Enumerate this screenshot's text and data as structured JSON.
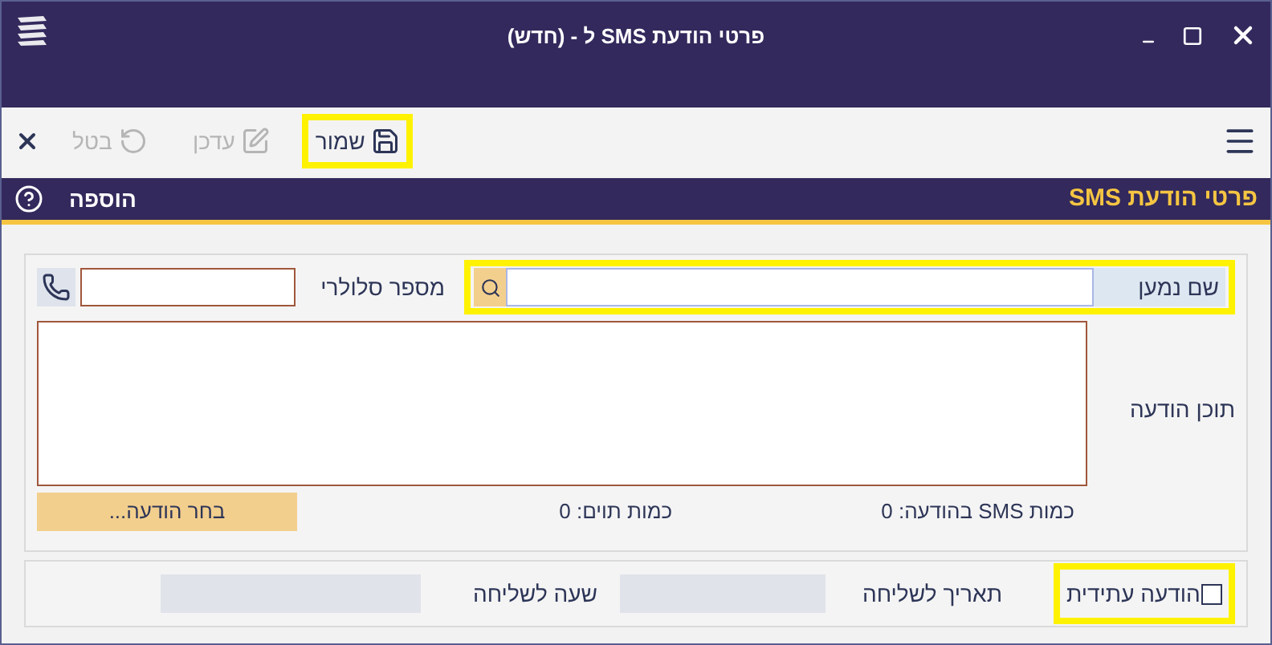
{
  "window": {
    "title": "פרטי הודעת SMS ל - (חדש)"
  },
  "toolbar": {
    "buttons": [
      {
        "label": "שמור",
        "kind": "save",
        "disabled": false,
        "highlighted": true
      },
      {
        "label": "עדכן",
        "kind": "edit",
        "disabled": true,
        "highlighted": false
      },
      {
        "label": "בטל",
        "kind": "undo",
        "disabled": true,
        "highlighted": false
      }
    ]
  },
  "section": {
    "title": "פרטי הודעת SMS",
    "mode": "הוספה"
  },
  "form": {
    "recipient_label": "שם נמען",
    "recipient_highlighted": true,
    "cell_label": "מספר סלולרי",
    "message_label": "תוכן הודעה",
    "choose_button": "בחר הודעה...",
    "sms_count_label": "כמות SMS בהודעה:",
    "sms_count": "0",
    "chars_label": "כמות תוים:",
    "chars": "0"
  },
  "schedule": {
    "future_label": "הודעה עתידית",
    "checked": false,
    "highlighted": true,
    "date_label": "תאריך לשליחה",
    "time_label": "שעה לשליחה"
  }
}
